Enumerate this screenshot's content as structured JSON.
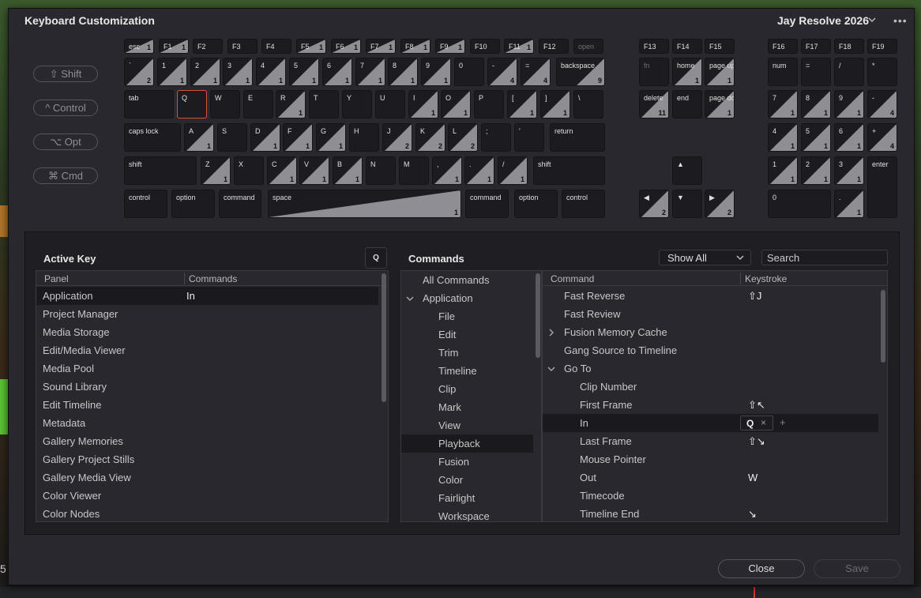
{
  "window": {
    "title": "Keyboard Customization",
    "preset_label": "Jay Resolve 2026",
    "more_label": "•••"
  },
  "background_text": "5",
  "modifiers": [
    {
      "label": "⇧ Shift",
      "name": "shift"
    },
    {
      "label": "^ Control",
      "name": "control"
    },
    {
      "label": "⌥ Opt",
      "name": "opt"
    },
    {
      "label": "⌘ Cmd",
      "name": "cmd"
    }
  ],
  "keyboard": {
    "function_row": [
      {
        "l": "esc",
        "c": "1"
      },
      {
        "l": "F1",
        "c": "1"
      },
      {
        "l": "F2",
        "c": ""
      },
      {
        "l": "F3",
        "c": ""
      },
      {
        "l": "F4",
        "c": ""
      },
      {
        "l": "F5",
        "c": "1"
      },
      {
        "l": "F6",
        "c": "1"
      },
      {
        "l": "F7",
        "c": "1"
      },
      {
        "l": "F8",
        "c": "1"
      },
      {
        "l": "F9",
        "c": "1"
      },
      {
        "l": "F10",
        "c": ""
      },
      {
        "l": "F11",
        "c": "1"
      },
      {
        "l": "F12",
        "c": ""
      },
      {
        "l": "open",
        "c": ""
      },
      {
        "l": "F13",
        "c": ""
      },
      {
        "l": "F14",
        "c": ""
      },
      {
        "l": "F15",
        "c": ""
      },
      {
        "l": "F16",
        "c": ""
      },
      {
        "l": "F17",
        "c": ""
      },
      {
        "l": "F18",
        "c": ""
      },
      {
        "l": "F19",
        "c": ""
      }
    ],
    "row1": [
      {
        "l": "`",
        "c": "2"
      },
      {
        "l": "1",
        "c": "1"
      },
      {
        "l": "2",
        "c": "1"
      },
      {
        "l": "3",
        "c": "1"
      },
      {
        "l": "4",
        "c": "1"
      },
      {
        "l": "5",
        "c": "1"
      },
      {
        "l": "6",
        "c": "1"
      },
      {
        "l": "7",
        "c": "1"
      },
      {
        "l": "8",
        "c": "1"
      },
      {
        "l": "9",
        "c": "1"
      },
      {
        "l": "0",
        "c": ""
      },
      {
        "l": "-",
        "c": "4"
      },
      {
        "l": "=",
        "c": "4"
      },
      {
        "l": "backspace",
        "c": "9"
      }
    ],
    "row2": [
      {
        "l": "tab",
        "c": ""
      },
      {
        "l": "Q",
        "c": ""
      },
      {
        "l": "W",
        "c": ""
      },
      {
        "l": "E",
        "c": ""
      },
      {
        "l": "R",
        "c": "1"
      },
      {
        "l": "T",
        "c": ""
      },
      {
        "l": "Y",
        "c": ""
      },
      {
        "l": "U",
        "c": ""
      },
      {
        "l": "I",
        "c": "1"
      },
      {
        "l": "O",
        "c": "1"
      },
      {
        "l": "P",
        "c": ""
      },
      {
        "l": "[",
        "c": "1"
      },
      {
        "l": "]",
        "c": "1"
      },
      {
        "l": "\\",
        "c": ""
      }
    ],
    "row3": [
      {
        "l": "caps lock",
        "c": ""
      },
      {
        "l": "A",
        "c": "1"
      },
      {
        "l": "S",
        "c": ""
      },
      {
        "l": "D",
        "c": "1"
      },
      {
        "l": "F",
        "c": "1"
      },
      {
        "l": "G",
        "c": "1"
      },
      {
        "l": "H",
        "c": ""
      },
      {
        "l": "J",
        "c": "2"
      },
      {
        "l": "K",
        "c": "2"
      },
      {
        "l": "L",
        "c": "2"
      },
      {
        "l": ";",
        "c": ""
      },
      {
        "l": "'",
        "c": ""
      },
      {
        "l": "return",
        "c": ""
      }
    ],
    "row4": [
      {
        "l": "shift",
        "c": ""
      },
      {
        "l": "Z",
        "c": "1"
      },
      {
        "l": "X",
        "c": ""
      },
      {
        "l": "C",
        "c": "1"
      },
      {
        "l": "V",
        "c": "1"
      },
      {
        "l": "B",
        "c": "1"
      },
      {
        "l": "N",
        "c": ""
      },
      {
        "l": "M",
        "c": ""
      },
      {
        "l": ",",
        "c": "1"
      },
      {
        "l": ".",
        "c": "1"
      },
      {
        "l": "/",
        "c": "1"
      },
      {
        "l": "shift",
        "c": ""
      }
    ],
    "row5": [
      {
        "l": "control",
        "c": ""
      },
      {
        "l": "option",
        "c": ""
      },
      {
        "l": "command",
        "c": ""
      },
      {
        "l": "space",
        "c": "1"
      },
      {
        "l": "command",
        "c": ""
      },
      {
        "l": "option",
        "c": ""
      },
      {
        "l": "control",
        "c": ""
      }
    ],
    "nav": [
      {
        "l": "fn",
        "c": ""
      },
      {
        "l": "home",
        "c": "1"
      },
      {
        "l": "page up",
        "c": "1"
      },
      {
        "l": "delete",
        "c": "11"
      },
      {
        "l": "end",
        "c": ""
      },
      {
        "l": "page down",
        "c": "1"
      },
      {
        "l": "▲",
        "c": ""
      },
      {
        "l": "◀",
        "c": "2"
      },
      {
        "l": "▼",
        "c": ""
      },
      {
        "l": "▶",
        "c": "2"
      }
    ],
    "numpad": [
      {
        "l": "num",
        "c": ""
      },
      {
        "l": "=",
        "c": ""
      },
      {
        "l": "/",
        "c": ""
      },
      {
        "l": "*",
        "c": ""
      },
      {
        "l": "7",
        "c": "1"
      },
      {
        "l": "8",
        "c": "1"
      },
      {
        "l": "9",
        "c": "1"
      },
      {
        "l": "-",
        "c": "4"
      },
      {
        "l": "4",
        "c": "1"
      },
      {
        "l": "5",
        "c": "1"
      },
      {
        "l": "6",
        "c": "1"
      },
      {
        "l": "+",
        "c": "4"
      },
      {
        "l": "1",
        "c": "1"
      },
      {
        "l": "2",
        "c": "1"
      },
      {
        "l": "3",
        "c": "1"
      },
      {
        "l": "enter",
        "c": ""
      },
      {
        "l": "0",
        "c": ""
      },
      {
        "l": ".",
        "c": "1"
      }
    ]
  },
  "active_key": {
    "title": "Active Key",
    "key": "Q",
    "col_panel": "Panel",
    "col_commands": "Commands",
    "rows": [
      {
        "panel": "Application",
        "cmd": "In"
      },
      {
        "panel": "Project Manager",
        "cmd": ""
      },
      {
        "panel": "Media Storage",
        "cmd": ""
      },
      {
        "panel": "Edit/Media Viewer",
        "cmd": ""
      },
      {
        "panel": "Media Pool",
        "cmd": ""
      },
      {
        "panel": "Sound Library",
        "cmd": ""
      },
      {
        "panel": "Edit Timeline",
        "cmd": ""
      },
      {
        "panel": "Metadata",
        "cmd": ""
      },
      {
        "panel": "Gallery Memories",
        "cmd": ""
      },
      {
        "panel": "Gallery Project Stills",
        "cmd": ""
      },
      {
        "panel": "Gallery Media View",
        "cmd": ""
      },
      {
        "panel": "Color Viewer",
        "cmd": ""
      },
      {
        "panel": "Color Nodes",
        "cmd": ""
      }
    ]
  },
  "commands": {
    "title": "Commands",
    "filter": "Show All",
    "search_placeholder": "Search",
    "tree": [
      {
        "label": "All Commands",
        "indent": 0,
        "exp": ""
      },
      {
        "label": "Application",
        "indent": 0,
        "exp": "v"
      },
      {
        "label": "File",
        "indent": 1,
        "exp": ""
      },
      {
        "label": "Edit",
        "indent": 1,
        "exp": ""
      },
      {
        "label": "Trim",
        "indent": 1,
        "exp": ""
      },
      {
        "label": "Timeline",
        "indent": 1,
        "exp": ""
      },
      {
        "label": "Clip",
        "indent": 1,
        "exp": ""
      },
      {
        "label": "Mark",
        "indent": 1,
        "exp": ""
      },
      {
        "label": "View",
        "indent": 1,
        "exp": ""
      },
      {
        "label": "Playback",
        "indent": 1,
        "exp": "",
        "sel": true
      },
      {
        "label": "Fusion",
        "indent": 1,
        "exp": ""
      },
      {
        "label": "Color",
        "indent": 1,
        "exp": ""
      },
      {
        "label": "Fairlight",
        "indent": 1,
        "exp": ""
      },
      {
        "label": "Workspace",
        "indent": 1,
        "exp": ""
      }
    ],
    "col_command": "Command",
    "col_keystroke": "Keystroke",
    "list": [
      {
        "cmd": "Fast Reverse",
        "key": "⇧J",
        "indent": 0,
        "exp": ""
      },
      {
        "cmd": "Fast Review",
        "key": "",
        "indent": 0,
        "exp": ""
      },
      {
        "cmd": "Fusion Memory Cache",
        "key": "",
        "indent": 0,
        "exp": ">"
      },
      {
        "cmd": "Gang Source to Timeline",
        "key": "",
        "indent": 0,
        "exp": ""
      },
      {
        "cmd": "Go To",
        "key": "",
        "indent": 0,
        "exp": "v"
      },
      {
        "cmd": "Clip Number",
        "key": "",
        "indent": 1,
        "exp": ""
      },
      {
        "cmd": "First Frame",
        "key": "⇧↖",
        "indent": 1,
        "exp": ""
      },
      {
        "cmd": "In",
        "key": "Q",
        "indent": 1,
        "exp": "",
        "editing": true
      },
      {
        "cmd": "Last Frame",
        "key": "⇧↘",
        "indent": 1,
        "exp": ""
      },
      {
        "cmd": "Mouse Pointer",
        "key": "",
        "indent": 1,
        "exp": ""
      },
      {
        "cmd": "Out",
        "key": "W",
        "indent": 1,
        "exp": ""
      },
      {
        "cmd": "Timecode",
        "key": "",
        "indent": 1,
        "exp": ""
      },
      {
        "cmd": "Timeline End",
        "key": "↘",
        "indent": 1,
        "exp": ""
      }
    ],
    "chip_close": "×",
    "chip_add": "+"
  },
  "buttons": {
    "close": "Close",
    "save": "Save"
  }
}
